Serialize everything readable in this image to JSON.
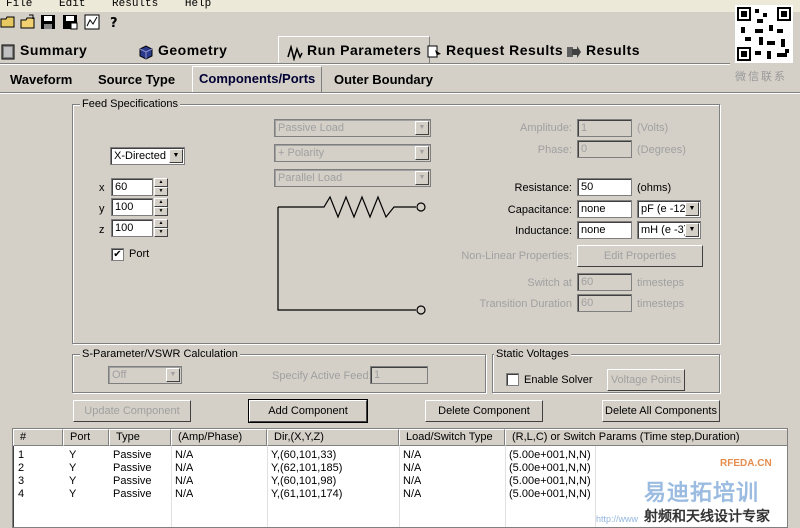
{
  "menu": [
    "File",
    "Edit",
    "Results",
    "Help"
  ],
  "toolbar_icons": [
    "open-folder-icon",
    "open-icon",
    "save-icon",
    "save-as-icon",
    "chart-icon",
    "help-icon"
  ],
  "main_tabs": [
    {
      "label": "Summary",
      "icon": "summary-icon"
    },
    {
      "label": "Geometry",
      "icon": "cube-icon"
    },
    {
      "label": "Run Parameters",
      "icon": "waveform-icon"
    },
    {
      "label": "Request Results",
      "icon": "request-icon"
    },
    {
      "label": "Results",
      "icon": "arrow-results-icon"
    }
  ],
  "sub_tabs": [
    "Waveform",
    "Source Type",
    "Components/Ports",
    "Outer Boundary"
  ],
  "active_main_tab": "Run Parameters",
  "active_sub_tab": "Components/Ports",
  "feed": {
    "group_title": "Feed Specifications",
    "direction": "X-Directed",
    "x_label": "x",
    "x": "60",
    "y_label": "y",
    "y": "100",
    "z_label": "z",
    "z": "100",
    "port_label": "Port",
    "port_checked": "✔",
    "load_type": "Passive Load",
    "polarity": "+ Polarity",
    "connection": "Parallel Load",
    "amplitude_label": "Amplitude:",
    "amplitude": "1",
    "amplitude_unit": "(Volts)",
    "phase_label": "Phase:",
    "phase": "0",
    "phase_unit": "(Degrees)",
    "resistance_label": "Resistance:",
    "resistance": "50",
    "resistance_unit": "(ohms)",
    "capacitance_label": "Capacitance:",
    "capacitance": "none",
    "capacitance_unit": "pF (e -12)",
    "inductance_label": "Inductance:",
    "inductance": "none",
    "inductance_unit": "mH (e -3)",
    "nonlinear_label": "Non-Linear Properties:",
    "edit_properties": "Edit Properties",
    "switch_at_label": "Switch at",
    "switch_at": "60",
    "switch_at_unit": "timesteps",
    "transition_label": "Transition Duration",
    "transition": "60",
    "transition_unit": "timesteps"
  },
  "sparam": {
    "group_title": "S-Parameter/VSWR Calculation",
    "mode": "Off",
    "active_feed_label": "Specify Active Feed:",
    "active_feed": "1"
  },
  "static_voltages": {
    "group_title": "Static Voltages",
    "enable_solver": "Enable Solver",
    "voltage_points": "Voltage Points"
  },
  "buttons": {
    "update": "Update Component",
    "add": "Add Component",
    "delete": "Delete Component",
    "delete_all": "Delete All Components"
  },
  "table": {
    "columns": [
      "#",
      "Port",
      "Type",
      "(Amp/Phase)",
      "Dir,(X,Y,Z)",
      "Load/Switch Type",
      "(R,L,C) or Switch Params (Time step,Duration)"
    ],
    "rows": [
      [
        "1",
        "Y",
        "Passive",
        "N/A",
        "Y,(60,101,33)",
        "N/A",
        "(5.00e+001,N,N)"
      ],
      [
        "2",
        "Y",
        "Passive",
        "N/A",
        "Y,(62,101,185)",
        "N/A",
        "(5.00e+001,N,N)"
      ],
      [
        "3",
        "Y",
        "Passive",
        "N/A",
        "Y,(60,101,98)",
        "N/A",
        "(5.00e+001,N,N)"
      ],
      [
        "4",
        "Y",
        "Passive",
        "N/A",
        "Y,(61,101,174)",
        "N/A",
        "(5.00e+001,N,N)"
      ]
    ]
  },
  "watermark": {
    "wechat": "微信联系",
    "site": "RFEDA.CN",
    "brand": "易迪拓培训",
    "slogan": "射频和天线设计专家",
    "url": "http://www"
  },
  "colors": {
    "background": "#d4d0c8",
    "brand_orange": "#e07020",
    "brand_blue": "#4a86c8"
  }
}
